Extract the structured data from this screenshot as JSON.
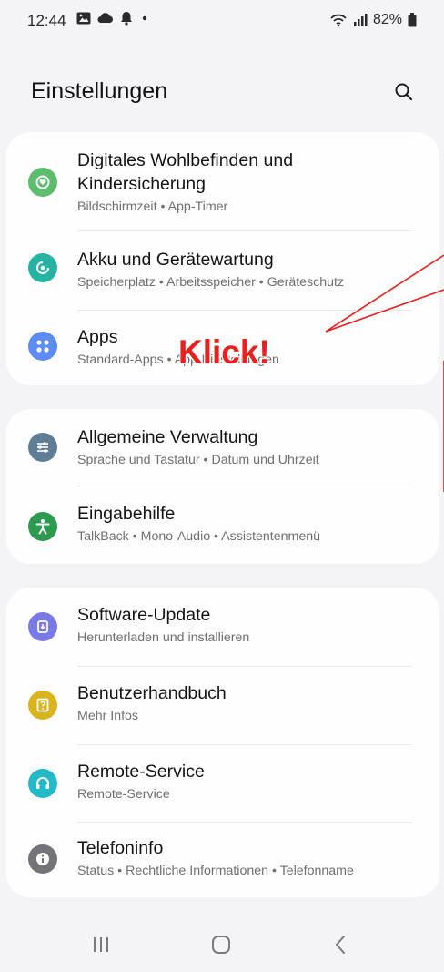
{
  "status_bar": {
    "time": "12:44",
    "battery": "82%",
    "left_icons": [
      "gallery-icon",
      "cloud-icon",
      "bell-icon",
      "dot-icon"
    ],
    "right_icons": [
      "wifi-icon",
      "signal-icon",
      "battery-icon"
    ]
  },
  "header": {
    "title": "Einstellungen",
    "search_icon": "search-icon"
  },
  "groups": [
    {
      "items": [
        {
          "title_line1": "Digitales Wohlbefinden und",
          "title_line2": "Kindersicherung",
          "subtitle": "Bildschirmzeit • App-Timer",
          "icon": "wellbeing-icon",
          "color": "#5cbd6e"
        },
        {
          "title": "Akku und Gerätewartung",
          "subtitle": "Speicherplatz • Arbeitsspeicher • Geräteschutz",
          "icon": "device-care-icon",
          "color": "#27b3a4"
        },
        {
          "title": "Apps",
          "subtitle": "Standard-Apps • App-Einstellungen",
          "icon": "apps-icon",
          "color": "#5d8cf5"
        }
      ]
    },
    {
      "items": [
        {
          "title": "Allgemeine Verwaltung",
          "subtitle": "Sprache und Tastatur • Datum und Uhrzeit",
          "icon": "general-management-icon",
          "color": "#5f7d95"
        },
        {
          "title": "Eingabehilfe",
          "subtitle": "TalkBack • Mono-Audio • Assistentenmenü",
          "icon": "accessibility-icon",
          "color": "#2d9b4f"
        }
      ]
    },
    {
      "items": [
        {
          "title": "Software-Update",
          "subtitle": "Herunterladen und installieren",
          "icon": "software-update-icon",
          "color": "#7a79e8"
        },
        {
          "title": "Benutzerhandbuch",
          "subtitle": "Mehr Infos",
          "icon": "user-manual-icon",
          "color": "#d9b41c"
        },
        {
          "title": "Remote-Service",
          "subtitle": "Remote-Service",
          "icon": "remote-service-icon",
          "color": "#24b9c7"
        },
        {
          "title": "Telefoninfo",
          "subtitle": "Status • Rechtliche Informationen • Telefonname",
          "icon": "phone-info-icon",
          "color": "#747478"
        }
      ]
    }
  ],
  "annotation": {
    "text": "Klick!",
    "color": "#e8211f"
  },
  "nav_bar": {
    "buttons": [
      "recents-icon",
      "home-icon",
      "back-icon"
    ]
  }
}
